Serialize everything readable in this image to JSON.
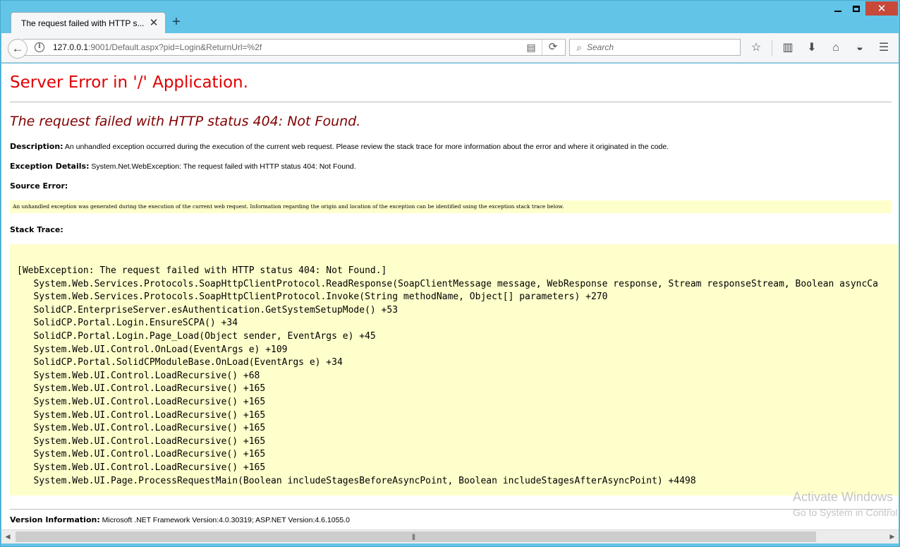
{
  "browser": {
    "tab_title": "The request failed with HTTP s...",
    "url_host": "127.0.0.1",
    "url_rest": ":9001/Default.aspx?pid=Login&ReturnUrl=%2f",
    "search_placeholder": "Search"
  },
  "page": {
    "title": "Server Error in '/' Application.",
    "subtitle": "The request failed with HTTP status 404: Not Found.",
    "description_label": "Description:",
    "description_text": " An unhandled exception occurred during the execution of the current web request. Please review the stack trace for more information about the error and where it originated in the code.",
    "exception_label": "Exception Details:",
    "exception_text": " System.Net.WebException: The request failed with HTTP status 404: Not Found.",
    "source_error_label": "Source Error:",
    "source_error_text": "An unhandled exception was generated during the execution of the current web request. Information regarding the origin and location of the exception can be identified using the exception stack trace below.",
    "stack_trace_label": "Stack Trace:",
    "stack_trace": [
      "[WebException: The request failed with HTTP status 404: Not Found.]",
      "   System.Web.Services.Protocols.SoapHttpClientProtocol.ReadResponse(SoapClientMessage message, WebResponse response, Stream responseStream, Boolean asyncCa",
      "   System.Web.Services.Protocols.SoapHttpClientProtocol.Invoke(String methodName, Object[] parameters) +270",
      "   SolidCP.EnterpriseServer.esAuthentication.GetSystemSetupMode() +53",
      "   SolidCP.Portal.Login.EnsureSCPA() +34",
      "   SolidCP.Portal.Login.Page_Load(Object sender, EventArgs e) +45",
      "   System.Web.UI.Control.OnLoad(EventArgs e) +109",
      "   SolidCP.Portal.SolidCPModuleBase.OnLoad(EventArgs e) +34",
      "   System.Web.UI.Control.LoadRecursive() +68",
      "   System.Web.UI.Control.LoadRecursive() +165",
      "   System.Web.UI.Control.LoadRecursive() +165",
      "   System.Web.UI.Control.LoadRecursive() +165",
      "   System.Web.UI.Control.LoadRecursive() +165",
      "   System.Web.UI.Control.LoadRecursive() +165",
      "   System.Web.UI.Control.LoadRecursive() +165",
      "   System.Web.UI.Control.LoadRecursive() +165",
      "   System.Web.UI.Page.ProcessRequestMain(Boolean includeStagesBeforeAsyncPoint, Boolean includeStagesAfterAsyncPoint) +4498"
    ],
    "version_label": "Version Information:",
    "version_text": " Microsoft .NET Framework Version:4.0.30319; ASP.NET Version:4.6.1055.0"
  },
  "watermark": {
    "line1": "Activate Windows",
    "line2": "Go to System in Control Panel to activate Windows."
  },
  "icons": {
    "back": "back-arrow-icon",
    "info": "info-icon",
    "reader": "reader-view-icon",
    "reload": "reload-icon",
    "search": "search-icon",
    "bookmark": "star-icon",
    "library": "bookmarks-list-icon",
    "downloads": "download-icon",
    "home": "home-icon",
    "pocket": "pocket-icon",
    "menu": "hamburger-menu-icon"
  },
  "colors": {
    "title_red": "#e10000",
    "subtitle_maroon": "#800000",
    "code_bg": "#ffffcc",
    "frame_blue": "#62c4e6"
  }
}
